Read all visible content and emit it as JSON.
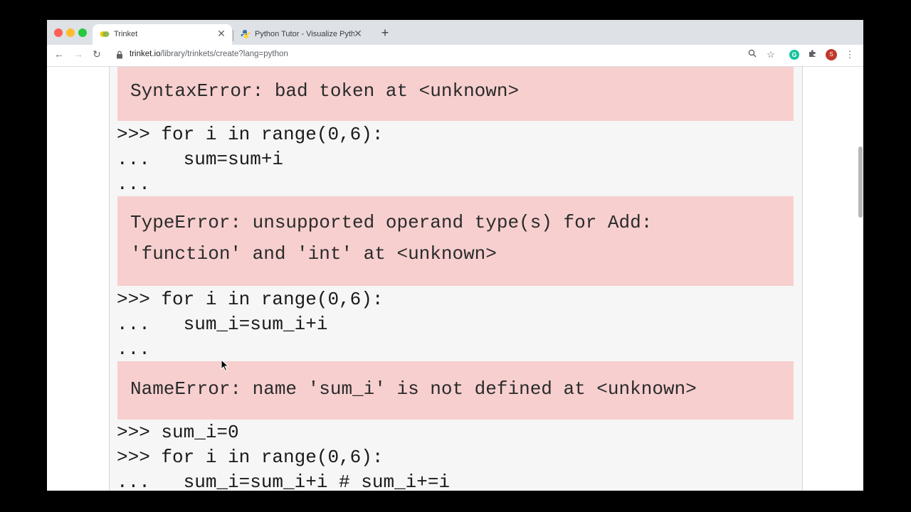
{
  "browser": {
    "tabs": [
      {
        "title": "Trinket",
        "favicon": "trinket-icon",
        "active": true
      },
      {
        "title": "Python Tutor - Visualize Python",
        "favicon": "python-icon",
        "active": false
      }
    ],
    "close_glyph": "✕",
    "new_tab_glyph": "+",
    "url_domain": "trinket.io",
    "url_path": "/library/trinkets/create?lang=python",
    "ext_letter": "G",
    "avatar_letter": "S"
  },
  "console": {
    "error1": "SyntaxError: bad token at <unknown>",
    "block1": [
      ">>> for i in range(0,6):",
      "...   sum=sum+i",
      "..."
    ],
    "error2": [
      "TypeError: unsupported operand type(s) for Add:",
      "'function' and 'int' at <unknown>"
    ],
    "block2": [
      ">>> for i in range(0,6):",
      "...   sum_i=sum_i+i",
      "..."
    ],
    "error3": "NameError: name 'sum_i' is not defined at <unknown>",
    "block3": [
      ">>> sum_i=0",
      ">>> for i in range(0,6):",
      "...   sum_i=sum_i+i # sum_i+=i"
    ]
  },
  "colors": {
    "error_bg": "#f7cfcf",
    "console_bg": "#f6f6f6",
    "tabbar_bg": "#dee1e6"
  }
}
